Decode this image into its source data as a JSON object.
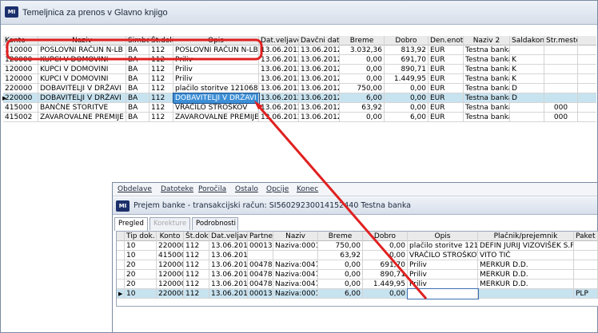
{
  "window1": {
    "title": "Temeljnica za prenos v Glavno knjigo",
    "columns": [
      "Konto",
      "Naziv",
      "Simbol",
      "Št.dok.",
      "Opis",
      "Dat.veljave",
      "Davčni dat.",
      "Breme",
      "Dobro",
      "Den.enota",
      "Naziv 2",
      "Saldakonti",
      "Str.mesto"
    ],
    "rows": [
      {
        "konto": "110000",
        "naziv": "POSLOVNI RAČUN N-LB",
        "simbol": "BA",
        "stdok": "112",
        "opis": "POSLOVNI RAČUN N-LB",
        "datvel": "13.06.2012",
        "davdat": "13.06.2012",
        "breme": "3.032,36",
        "dobro": "813,92",
        "den": "EUR",
        "naziv2": "Testna banka",
        "salda": "",
        "strm": ""
      },
      {
        "konto": "120000",
        "naziv": "KUPCI V DOMOVINI",
        "simbol": "BA",
        "stdok": "112",
        "opis": "Priliv",
        "datvel": "13.06.2012",
        "davdat": "13.06.2012",
        "breme": "0,00",
        "dobro": "691,70",
        "den": "EUR",
        "naziv2": "Testna banka",
        "salda": "K",
        "strm": ""
      },
      {
        "konto": "120000",
        "naziv": "KUPCI V DOMOVINI",
        "simbol": "BA",
        "stdok": "112",
        "opis": "Priliv",
        "datvel": "13.06.2012",
        "davdat": "13.06.2012",
        "breme": "0,00",
        "dobro": "890,71",
        "den": "EUR",
        "naziv2": "Testna banka",
        "salda": "K",
        "strm": ""
      },
      {
        "konto": "120000",
        "naziv": "KUPCI V DOMOVINI",
        "simbol": "BA",
        "stdok": "112",
        "opis": "Priliv",
        "datvel": "13.06.2012",
        "davdat": "13.06.2012",
        "breme": "0,00",
        "dobro": "1.449,95",
        "den": "EUR",
        "naziv2": "Testna banka",
        "salda": "K",
        "strm": ""
      },
      {
        "konto": "220000",
        "naziv": "DOBAVITELJI V DRŽAVI",
        "simbol": "BA",
        "stdok": "112",
        "opis": "plačilo storitve 121068",
        "datvel": "13.06.2012",
        "davdat": "13.06.2012",
        "breme": "750,00",
        "dobro": "0,00",
        "den": "EUR",
        "naziv2": "Testna banka",
        "salda": "D",
        "strm": ""
      },
      {
        "konto": "220000",
        "naziv": "DOBAVITELJI V DRŽAVI",
        "simbol": "BA",
        "stdok": "112",
        "opis": "DOBAVITELJI V DRŽAVI",
        "datvel": "13.06.2012",
        "davdat": "13.06.2012",
        "breme": "6,00",
        "dobro": "0,00",
        "den": "EUR",
        "naziv2": "Testna banka",
        "salda": "D",
        "strm": ""
      },
      {
        "konto": "415000",
        "naziv": "BANČNE STORITVE",
        "simbol": "BA",
        "stdok": "112",
        "opis": "VRAČILO STROŠKOV",
        "datvel": "13.06.2012",
        "davdat": "13.06.2012",
        "breme": "63,92",
        "dobro": "0,00",
        "den": "EUR",
        "naziv2": "Testna banka",
        "salda": "",
        "strm": "000"
      },
      {
        "konto": "415002",
        "naziv": "ZAVAROVALNE PREMIJE",
        "simbol": "BA",
        "stdok": "112",
        "opis": "ZAVAROVALNE PREMIJE",
        "datvel": "13.06.2012",
        "davdat": "13.06.2012",
        "breme": "0,00",
        "dobro": "6,00",
        "den": "EUR",
        "naziv2": "Testna banka",
        "salda": "",
        "strm": "000"
      }
    ]
  },
  "window2": {
    "menu": [
      "Obdelave",
      "Datoteke",
      "Poročila",
      "Ostalo",
      "Opcije",
      "Konec"
    ],
    "title": "Prejem banke - transakcijski račun: SI56029230014152440  Testna banka",
    "tabs": [
      "Pregled",
      "Korekture",
      "Podrobnosti"
    ],
    "columns": [
      "Tip dok.",
      "Konto",
      "Št.dok.",
      "Dat.veljave",
      "Partner",
      "Naziv",
      "Breme",
      "Dobro",
      "Opis",
      "Plačnik/prejemnik",
      "Paket"
    ],
    "rows": [
      {
        "tip": "10",
        "konto": "220000",
        "stdok": "112",
        "datvel": "13.06.2012",
        "partner": "00013",
        "naziv": "Naziva:00013",
        "breme": "750,00",
        "dobro": "0,00",
        "opis": "plačilo storitve 121068",
        "placnik": "DEFIN JURIJ VIZOVIŠEK S.P.",
        "paket": ""
      },
      {
        "tip": "10",
        "konto": "415000",
        "stdok": "112",
        "datvel": "13.06.2012",
        "partner": "",
        "naziv": "",
        "breme": "63,92",
        "dobro": "0,00",
        "opis": "VRAČILO STROŠKOV",
        "placnik": "VITO TIČ",
        "paket": ""
      },
      {
        "tip": "20",
        "konto": "120000",
        "stdok": "112",
        "datvel": "13.06.2012",
        "partner": "00478",
        "naziv": "Naziva:00478",
        "breme": "0,00",
        "dobro": "691,70",
        "opis": "Priliv",
        "placnik": "MERKUR D.D.",
        "paket": ""
      },
      {
        "tip": "20",
        "konto": "120000",
        "stdok": "112",
        "datvel": "13.06.2012",
        "partner": "00478",
        "naziv": "Naziva:00478",
        "breme": "0,00",
        "dobro": "890,71",
        "opis": "Priliv",
        "placnik": "MERKUR D.D.",
        "paket": ""
      },
      {
        "tip": "20",
        "konto": "120000",
        "stdok": "112",
        "datvel": "13.06.2012",
        "partner": "00478",
        "naziv": "Naziva:00478",
        "breme": "0,00",
        "dobro": "1.449,95",
        "opis": "Priliv",
        "placnik": "MERKUR D.D.",
        "paket": ""
      },
      {
        "tip": "10",
        "konto": "220000",
        "stdok": "112",
        "datvel": "13.06.2012",
        "partner": "00013",
        "naziv": "Naziva:00013",
        "breme": "6,00",
        "dobro": "0,00",
        "opis": "",
        "placnik": "",
        "paket": "PLP"
      }
    ]
  },
  "colors": {
    "annotation": "#e02020",
    "selected_row": "#c8e3f0",
    "edit_cell": "#3d8fd6"
  },
  "icons": [
    "app-logo-icon",
    "row-indicator-icon"
  ]
}
